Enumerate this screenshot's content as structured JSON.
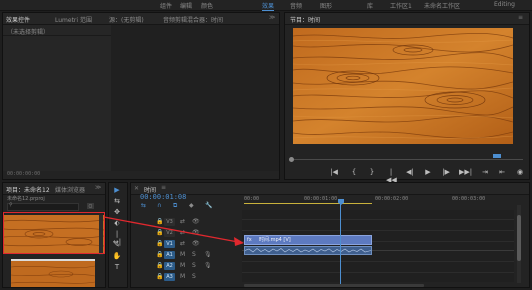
{
  "workspaces": [
    {
      "label": "组件",
      "active": false
    },
    {
      "label": "编辑",
      "active": false
    },
    {
      "label": "颜色",
      "active": false
    },
    {
      "label": "效果",
      "active": true
    },
    {
      "label": "音频",
      "active": false
    },
    {
      "label": "图形",
      "active": false
    },
    {
      "label": "库",
      "active": false
    },
    {
      "label": "工作区1",
      "active": false
    },
    {
      "label": "未命名工作区",
      "active": false
    },
    {
      "label": "Editing",
      "active": false
    }
  ],
  "effect_controls": {
    "tabs": [
      "效果控件",
      "Lumetri 范围",
      "源：(无剪辑)",
      "音频剪辑混合器：时间"
    ],
    "body_text": "（未选择剪辑）",
    "timecode": "00:00:00:00"
  },
  "program": {
    "title": "节目：时间",
    "controls": [
      "|◀",
      "{",
      "}",
      "|◀◀",
      "◀|",
      "▶",
      "|▶",
      "▶▶|",
      "⇥",
      "⇤",
      "◉"
    ]
  },
  "project": {
    "tabs": [
      "项目：未命名12",
      "媒体浏览器"
    ],
    "file_name": "未命名12.prproj",
    "search_placeholder": ""
  },
  "timeline": {
    "tab": "时间",
    "timecode": "00:00:01:08",
    "ruler_labels": [
      "00:00",
      "00:00:01:00",
      "00:00:02:00",
      "00:00:03:00"
    ],
    "video_tracks": [
      "V3",
      "V2",
      "V1"
    ],
    "audio_tracks": [
      "A1",
      "A2",
      "A3"
    ],
    "clip_label": "时间.mp4 [V]",
    "playhead_fraction": 0.3
  },
  "tools": [
    "▶",
    "⇆",
    "✥",
    "⬖",
    "|↔|",
    "✎",
    "✋",
    "T"
  ],
  "colors": {
    "accent_blue": "#4d8fd1",
    "clip_purple": "#5d7ac0",
    "highlight_red": "#e0282e",
    "work_area_yellow": "#c9b23c"
  }
}
